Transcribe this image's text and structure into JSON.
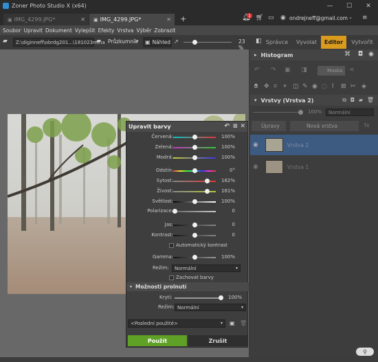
{
  "app": {
    "title": "Zoner Photo Studio X (x64)"
  },
  "tabs": [
    {
      "label": "IMG_4299.JPG*"
    },
    {
      "label": "IMG_4299.JPG*"
    }
  ],
  "header": {
    "account": "ondrejneff@gmail.com",
    "notification_count": "1"
  },
  "menu": [
    "Soubor",
    "Upravit",
    "Dokument",
    "Vylepšit",
    "Efekty",
    "Vrstva",
    "Výběr",
    "Zobrazit"
  ],
  "toolbar": {
    "path": "Z:\\diginneff\\obrdg201...\\181023mlha",
    "browse_label": "Průzkumník",
    "preview_label": "Náhled",
    "zoom": "23 %"
  },
  "modes": [
    "Správce",
    "Vyvolat",
    "Editor",
    "Vytvořit"
  ],
  "active_mode": "Editor",
  "right": {
    "histogram_label": "Histogram",
    "layers_label": "Vrstvy (Vrstva 2)",
    "opacity": "100%",
    "blend": "Normální",
    "edit_label": "Úpravy",
    "new_layer_label": "Nová vrstva",
    "fx_label": "fx",
    "mask_label": "Maska",
    "layers": [
      {
        "name": "Vrstva 2"
      },
      {
        "name": "Vrstva 1"
      }
    ]
  },
  "dialog": {
    "title": "Upravit barvy",
    "sliders": [
      {
        "label": "Červená:",
        "value": "100%",
        "pos": 0.5
      },
      {
        "label": "Zelená:",
        "value": "100%",
        "pos": 0.5
      },
      {
        "label": "Modrá:",
        "value": "100%",
        "pos": 0.5
      },
      {
        "label": "Odstín:",
        "value": "0°",
        "pos": 0.5
      },
      {
        "label": "Sytost:",
        "value": "162%",
        "pos": 0.81
      },
      {
        "label": "Živost:",
        "value": "161%",
        "pos": 0.805
      },
      {
        "label": "Světlost:",
        "value": "100%",
        "pos": 0.5
      },
      {
        "label": "Polarizace:",
        "value": "0",
        "pos": 0.0
      },
      {
        "label": "Jas:",
        "value": "0",
        "pos": 0.5
      },
      {
        "label": "Kontrast:",
        "value": "0",
        "pos": 0.5
      },
      {
        "label": "Gamma:",
        "value": "100%",
        "pos": 0.5
      }
    ],
    "auto_contrast": "Automatický kontrast",
    "mode_label": "Režim:",
    "mode_value": "Normální",
    "keep_colors": "Zachovat barvy",
    "blend_section": "Možnosti prolnutí",
    "opacity_label": "Krytí:",
    "opacity_value": "100%",
    "opacity_pos": 1.0,
    "blend_mode_label": "Režim:",
    "blend_mode_value": "Normální",
    "preset": "<Poslední použité>",
    "apply": "Použít",
    "cancel": "Zrušit"
  },
  "colors": {
    "accent": "#d99a1e",
    "apply": "#5fa026",
    "selected_layer": "#3d5a80"
  }
}
